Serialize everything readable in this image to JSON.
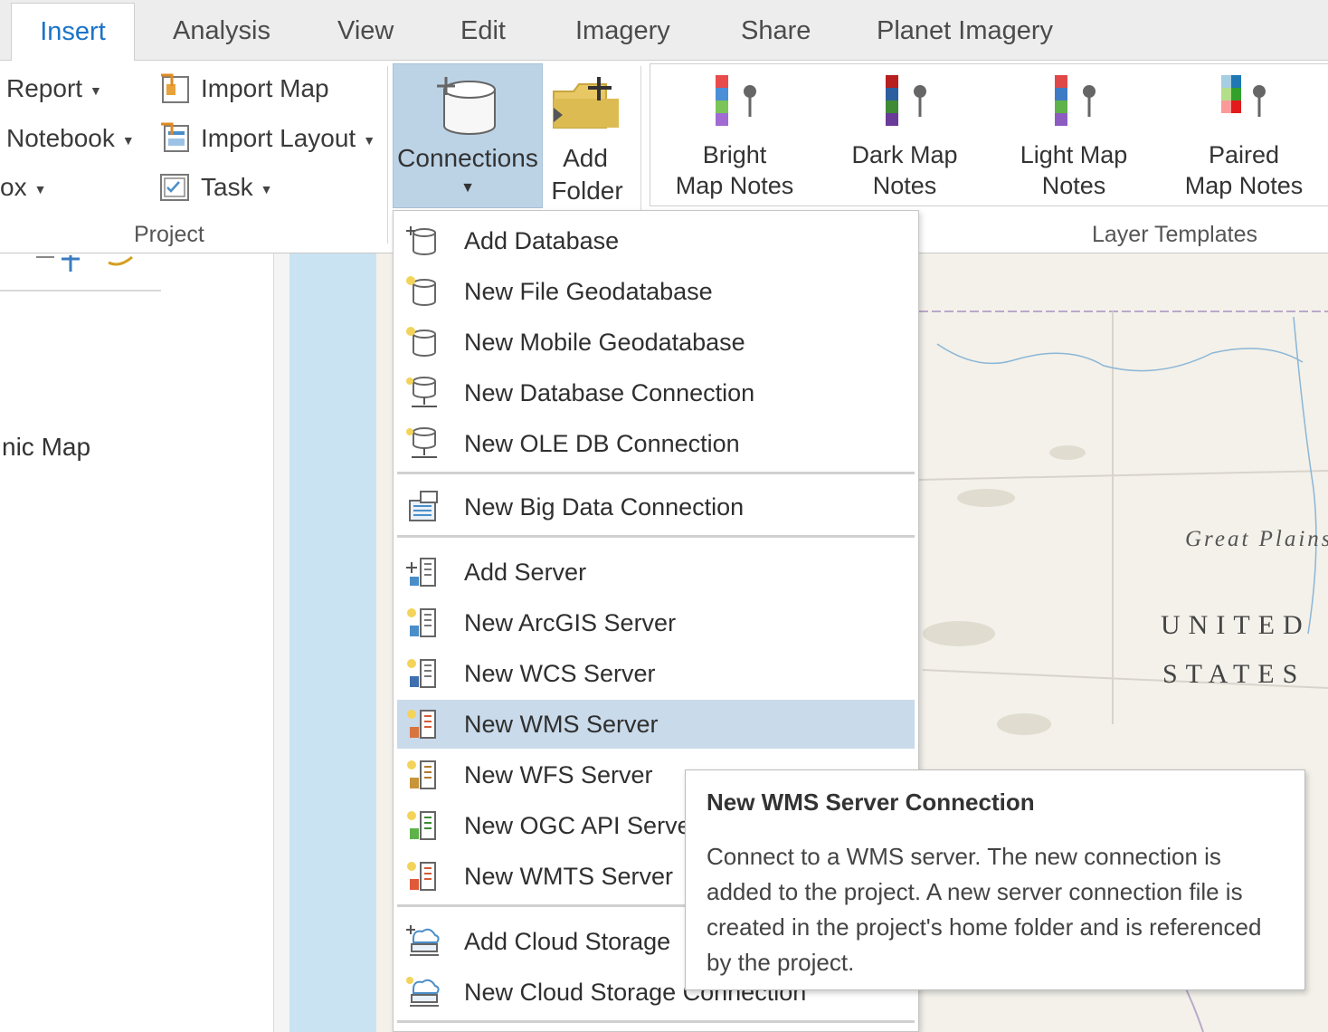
{
  "tabs": {
    "active": "Insert",
    "others": [
      "Analysis",
      "View",
      "Edit",
      "Imagery",
      "Share",
      "Planet Imagery"
    ]
  },
  "project_group": {
    "report": "Report",
    "notebook": "Notebook",
    "toolbox": "ox",
    "import_map": "Import Map",
    "import_layout": "Import Layout",
    "task": "Task",
    "label": "Project"
  },
  "connections_button": {
    "label": "Connections"
  },
  "add_folder_button": {
    "line1": "Add",
    "line2": "Folder"
  },
  "layer_templates": {
    "label": "Layer Templates",
    "items": [
      {
        "line1": "Bright",
        "line2": "Map Notes"
      },
      {
        "line1": "Dark Map",
        "line2": "Notes"
      },
      {
        "line1": "Light Map",
        "line2": "Notes"
      },
      {
        "line1": "Paired",
        "line2": "Map Notes"
      }
    ]
  },
  "left_pane": {
    "map_name_fragment": "nic Map"
  },
  "map": {
    "great_plains": "Great Plains",
    "country_line1": "UNITED",
    "country_line2": "STATES"
  },
  "menu": {
    "items": [
      {
        "label": "Add Database",
        "icon": "database-add-icon"
      },
      {
        "label": "New File Geodatabase",
        "icon": "file-geodatabase-icon"
      },
      {
        "label": "New Mobile Geodatabase",
        "icon": "mobile-geodatabase-icon"
      },
      {
        "label": "New Database Connection",
        "icon": "database-connection-icon"
      },
      {
        "label": "New OLE DB Connection",
        "icon": "oledb-connection-icon"
      },
      {
        "label": "New Big Data Connection",
        "icon": "big-data-connection-icon"
      },
      {
        "label": "Add Server",
        "icon": "add-server-icon"
      },
      {
        "label": "New ArcGIS Server",
        "icon": "arcgis-server-icon"
      },
      {
        "label": "New WCS Server",
        "icon": "wcs-server-icon"
      },
      {
        "label": "New WMS Server",
        "icon": "wms-server-icon"
      },
      {
        "label": "New WFS Server",
        "icon": "wfs-server-icon"
      },
      {
        "label": "New OGC API Server",
        "icon": "ogc-api-server-icon"
      },
      {
        "label": "New WMTS Server",
        "icon": "wmts-server-icon"
      },
      {
        "label": "Add Cloud Storage",
        "icon": "add-cloud-storage-icon"
      },
      {
        "label": "New Cloud Storage Connection",
        "icon": "cloud-storage-connection-icon"
      }
    ],
    "highlighted": "New WMS Server"
  },
  "tooltip": {
    "title": "New WMS Server Connection",
    "body": "Connect to a WMS server. The new connection is added to the project. A new server connection file is created in the project's home folder and is referenced by the project."
  },
  "colors": {
    "active_tab_text": "#1a73c8",
    "selected_button_bg": "#bcd3e6",
    "menu_highlight_bg": "#c9daea",
    "ocean": "#c9e3f3"
  }
}
